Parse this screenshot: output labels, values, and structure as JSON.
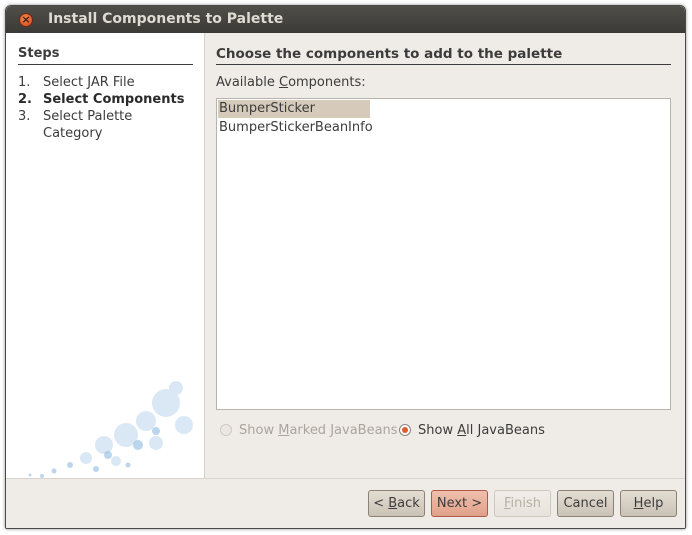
{
  "window": {
    "title": "Install Components to Palette",
    "close_icon": "close-icon"
  },
  "steps": {
    "heading": "Steps",
    "items": [
      {
        "num": "1.",
        "label": "Select JAR File",
        "current": false
      },
      {
        "num": "2.",
        "label": "Select Components",
        "current": true
      },
      {
        "num": "3.",
        "label": "Select Palette Category",
        "current": false
      }
    ]
  },
  "main": {
    "heading": "Choose the components to add to the palette",
    "available_label_pre": "Available ",
    "available_label_mnemonic": "C",
    "available_label_post": "omponents:",
    "components": [
      {
        "label": "BumperSticker",
        "selected": true
      },
      {
        "label": "BumperStickerBeanInfo",
        "selected": false
      }
    ],
    "radio_marked": {
      "pre": "Show ",
      "mnemonic": "M",
      "post": "arked JavaBeans",
      "checked": false,
      "enabled": false
    },
    "radio_all": {
      "pre": "Show ",
      "mnemonic": "A",
      "post": "ll JavaBeans",
      "checked": true,
      "enabled": true
    }
  },
  "buttons": {
    "back": {
      "pre": "< ",
      "mnemonic": "B",
      "post": "ack"
    },
    "next": {
      "label": "Next >"
    },
    "finish": {
      "pre": "",
      "mnemonic": "F",
      "post": "inish"
    },
    "cancel": {
      "label": "Cancel"
    },
    "help": {
      "pre": "",
      "mnemonic": "H",
      "post": "elp"
    }
  },
  "colors": {
    "titlebar": "#3b3a36",
    "selection": "#d6cbbb",
    "radio_accent": "#e05a2a",
    "next_button": "#e0a08a"
  }
}
